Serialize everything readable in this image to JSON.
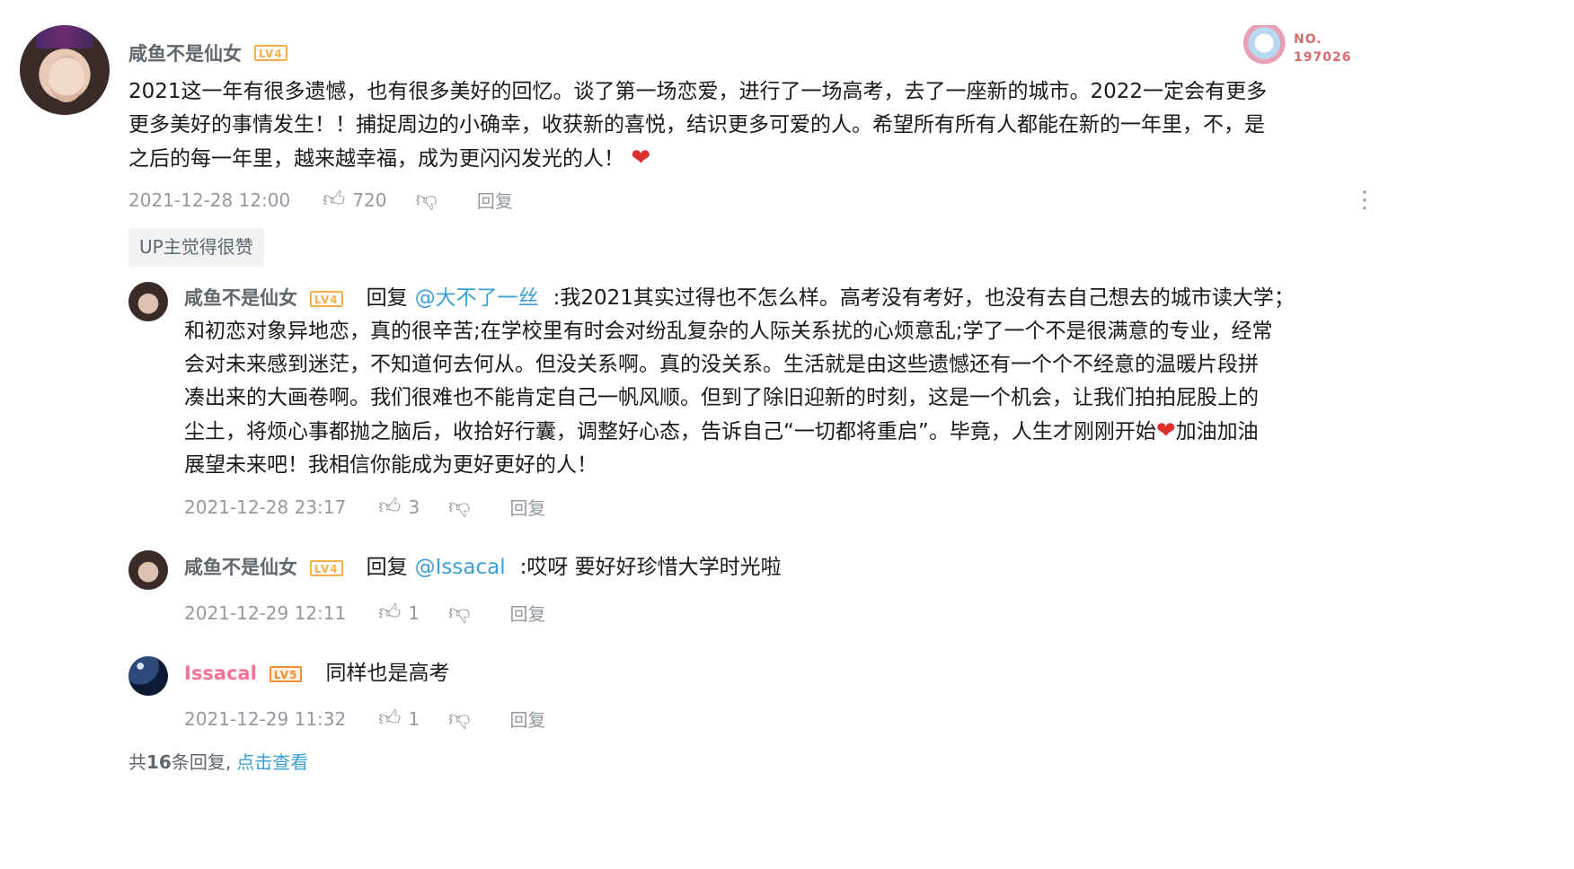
{
  "main_comment": {
    "username": "咸鱼不是仙女",
    "level": "LV4",
    "badge": {
      "no_label": "NO.",
      "no_number": "197026"
    },
    "text_lines": [
      "2021这一年有很多遗憾，也有很多美好的回忆。谈了第一场恋爱，进行了一场高考，去了一座新的城市。2022一定会有更多",
      "更多美好的事情发生！！捕捉周边的小确幸，收获新的喜悦，结识更多可爱的人。希望所有所有人都能在新的一年里，不，是",
      "之后的每一年里，越来越幸福，成为更闪闪发光的人！"
    ],
    "time": "2021-12-28 12:00",
    "likes": "720",
    "reply_label": "回复",
    "up_badge": "UP主觉得很赞",
    "like_icon": "thumbs-up-icon",
    "dislike_icon": "thumbs-down-icon",
    "heart_icon": "heart-icon"
  },
  "replies": [
    {
      "username": "咸鱼不是仙女",
      "level": "LV4",
      "reply_prefix": "回复",
      "at_user": "@大不了一丝",
      "text_first": ":我2021其实过得也不怎么样。高考没有考好，也没有去自己想去的城市读大学；",
      "text_lines": [
        "和初恋对象异地恋，真的很辛苦;在学校里有时会对纷乱复杂的人际关系扰的心烦意乱;学了一个不是很满意的专业，经常",
        "会对未来感到迷茫，不知道何去何从。但没关系啊。真的没关系。生活就是由这些遗憾还有一个个不经意的温暖片段拼",
        "凑出来的大画卷啊。我们很难也不能肯定自己一帆风顺。但到了除旧迎新的时刻，这是一个机会，让我们拍拍屁股上的"
      ],
      "text_line5_a": "尘土，将烦心事都抛之脑后，收拾好行囊，调整好心态，告诉自己“一切都将重启”。毕竟，人生才刚刚开始",
      "text_line5_b": "加油加油",
      "text_line6": "展望未来吧！我相信你能成为更好更好的人！",
      "time": "2021-12-28 23:17",
      "likes": "3",
      "reply_label": "回复"
    },
    {
      "username": "咸鱼不是仙女",
      "level": "LV4",
      "reply_prefix": "回复",
      "at_user": "@Issacal",
      "text_first": ":哎呀 要好好珍惜大学时光啦",
      "time": "2021-12-29 12:11",
      "likes": "1",
      "reply_label": "回复"
    },
    {
      "username": "Issacal",
      "level": "LV5",
      "text_first": "同样也是高考",
      "time": "2021-12-29 11:32",
      "likes": "1",
      "reply_label": "回复"
    }
  ],
  "footer": {
    "prefix": "共",
    "count": "16",
    "suffix": "条回复,",
    "link": "点击查看"
  }
}
